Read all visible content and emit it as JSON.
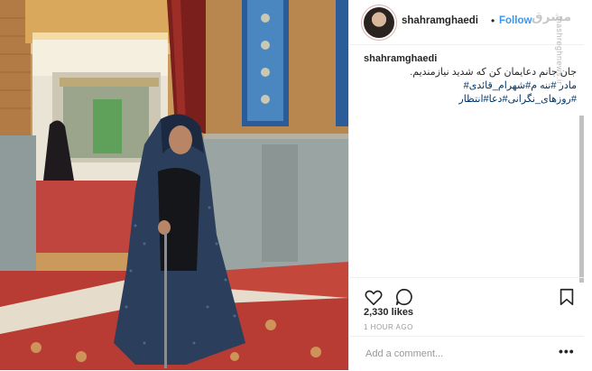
{
  "post": {
    "username": "shahramghaedi",
    "follow_label": "Follow",
    "separator": "•",
    "caption": {
      "username": "shahramghaedi",
      "text": "جان جانم دعایمان کن که شدید نیازمندیم.",
      "hashtags_line1": "مادر #ننه م#شهرام_قائدی#",
      "hashtags_line2": "#روزهای_نگرانی#دعا#انتظار"
    },
    "likes": "2,330 likes",
    "timestamp": "1 HOUR AGO",
    "comment_placeholder": "Add a comment...",
    "more_icon": "•••"
  },
  "icons": {
    "like": "heart-icon",
    "comment": "comment-bubble-icon",
    "save": "bookmark-icon",
    "more": "more-options-icon"
  },
  "watermark": {
    "logo": "مشرق",
    "url": "mashreghnews.ir"
  },
  "colors": {
    "follow": "#3897f0",
    "hashtag": "#003569",
    "text": "#262626",
    "muted": "#999999"
  }
}
